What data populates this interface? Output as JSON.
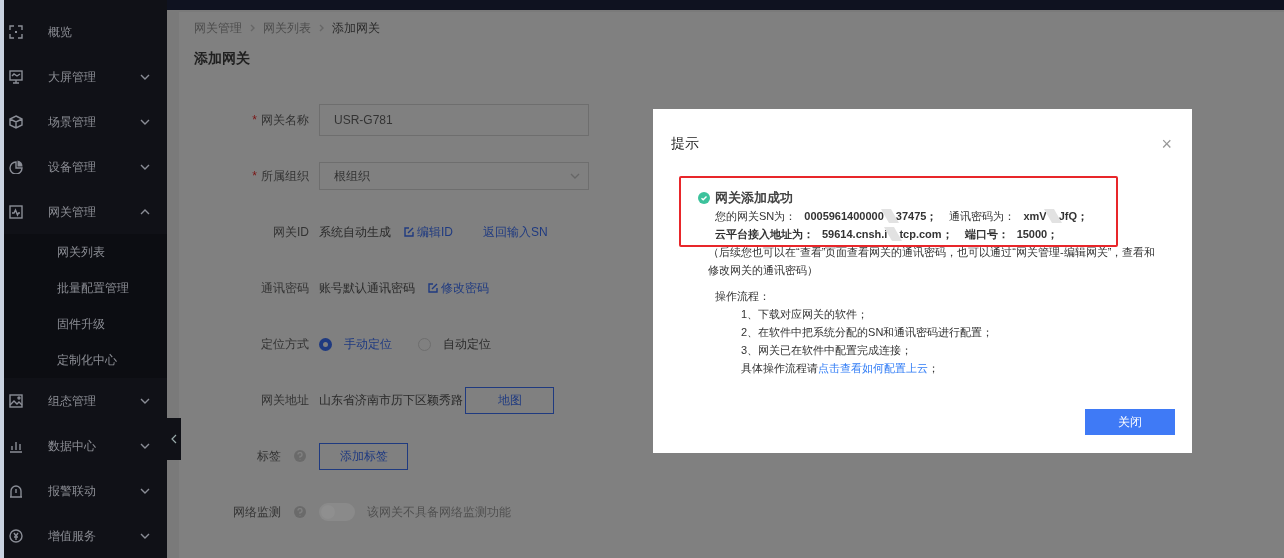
{
  "sidebar": {
    "items": [
      {
        "label": "概览",
        "expandable": false
      },
      {
        "label": "大屏管理",
        "expandable": true,
        "expanded": false
      },
      {
        "label": "场景管理",
        "expandable": true,
        "expanded": false
      },
      {
        "label": "设备管理",
        "expandable": true,
        "expanded": false
      },
      {
        "label": "网关管理",
        "expandable": true,
        "expanded": true,
        "children": [
          {
            "label": "网关列表"
          },
          {
            "label": "批量配置管理"
          },
          {
            "label": "固件升级"
          },
          {
            "label": "定制化中心"
          }
        ]
      },
      {
        "label": "组态管理",
        "expandable": true,
        "expanded": false
      },
      {
        "label": "数据中心",
        "expandable": true,
        "expanded": false
      },
      {
        "label": "报警联动",
        "expandable": true,
        "expanded": false
      },
      {
        "label": "增值服务",
        "expandable": true,
        "expanded": false
      }
    ]
  },
  "breadcrumb": [
    "网关管理",
    "网关列表",
    "添加网关"
  ],
  "page_title": "添加网关",
  "form": [
    {
      "kind": "input",
      "required_mark": "*",
      "label": "网关名称",
      "value": "USR-G781"
    },
    {
      "kind": "select",
      "required_mark": "*",
      "label": "所属组织",
      "value": "根组织"
    },
    {
      "kind": "links",
      "label": "网关ID",
      "text": "系统自动生成",
      "links": [
        {
          "label": "编辑ID",
          "icon": true
        },
        {
          "label": "返回输入SN",
          "icon": false
        }
      ]
    },
    {
      "kind": "links",
      "label": "通讯密码",
      "text": "账号默认通讯密码",
      "links": [
        {
          "label": "修改密码",
          "icon": true
        }
      ]
    },
    {
      "kind": "radio",
      "label": "定位方式",
      "options": [
        {
          "label": "手动定位",
          "selected": true
        },
        {
          "label": "自动定位",
          "selected": false
        }
      ]
    },
    {
      "kind": "address",
      "label": "网关地址",
      "text": "山东省济南市历下区颖秀路",
      "button": "地图"
    },
    {
      "kind": "button",
      "label": "标签",
      "help": true,
      "button": "添加标签"
    },
    {
      "kind": "switch",
      "label": "网络监测",
      "help": true,
      "on": false,
      "text": "该网关不具备网络监测功能"
    }
  ],
  "dialog": {
    "title": "提示",
    "close": "×",
    "success_title": "网关添加成功",
    "sn_label": "您的网关SN为：",
    "sn_value": [
      "0005961400000",
      "37475；"
    ],
    "password_label": "通讯密码为：",
    "password_value": [
      "xmV",
      "JfQ；"
    ],
    "address_label": "云平台接入地址为：",
    "address_value": [
      "59614.cnsh.i",
      "tcp.com；"
    ],
    "port_label": "端口号：",
    "port_value": "15000；",
    "note": "（后续您也可以在“查看”页面查看网关的通讯密码，也可以通过“网关管理-编辑网关”，查看和修改网关的通讯密码）",
    "steps_title": "操作流程：",
    "steps": [
      "1、下载对应网关的软件；",
      "2、在软件中把系统分配的SN和通讯密码进行配置；",
      "3、网关已在软件中配置完成连接；"
    ],
    "help_prefix": "具体操作流程请",
    "help_link": "点击查看如何配置上云",
    "help_suffix": "；",
    "button": "关闭"
  }
}
